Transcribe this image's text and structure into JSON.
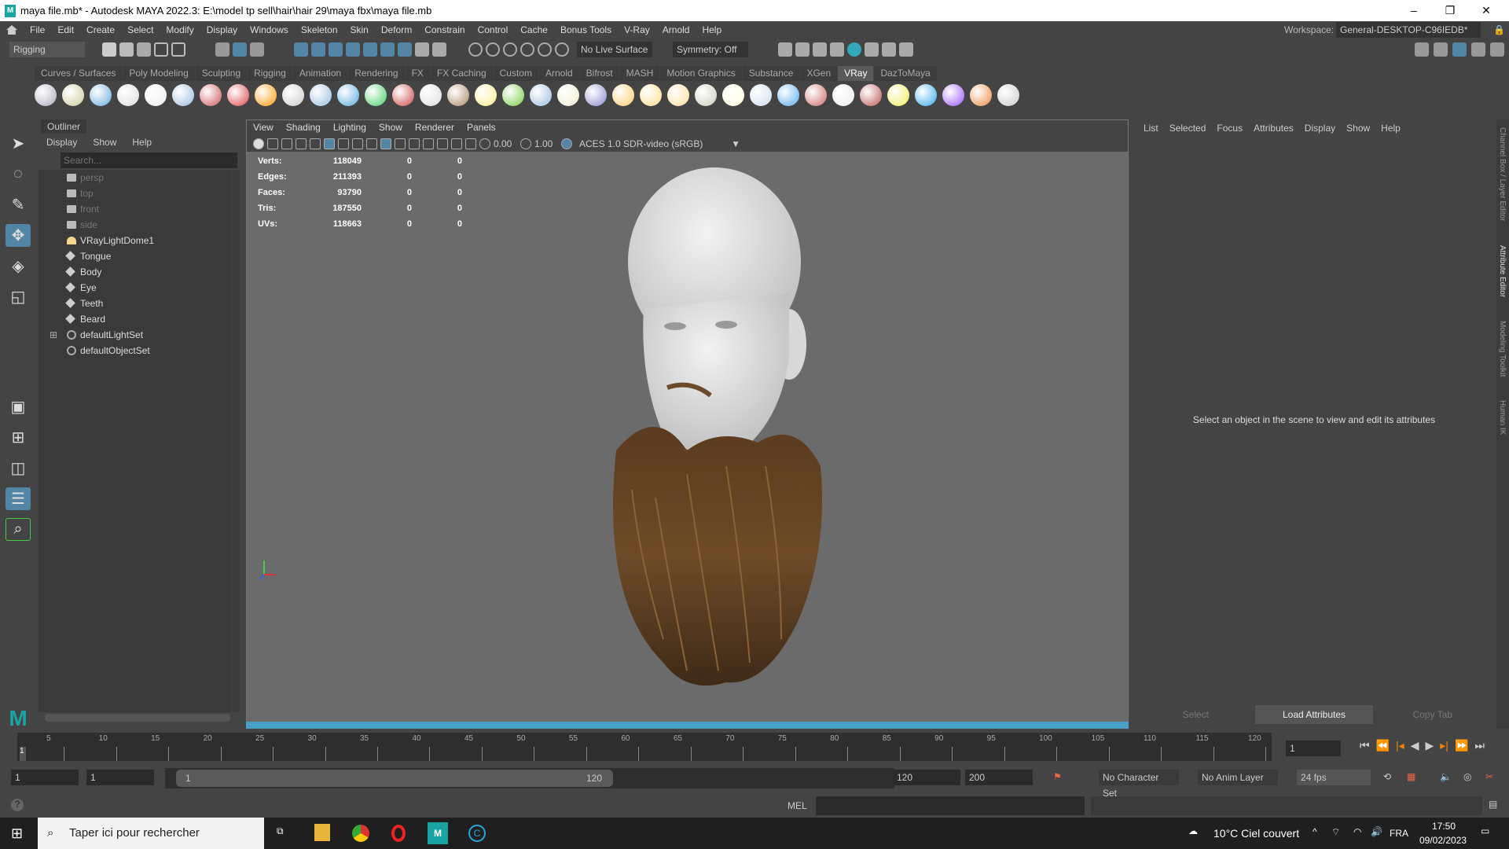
{
  "window": {
    "title": "maya file.mb* - Autodesk MAYA 2022.3: E:\\model tp sell\\hair\\hair 29\\maya fbx\\maya file.mb",
    "minimize": "–",
    "maximize": "❐",
    "close": "✕"
  },
  "menubar": {
    "items": [
      "File",
      "Edit",
      "Create",
      "Select",
      "Modify",
      "Display",
      "Windows",
      "Skeleton",
      "Skin",
      "Deform",
      "Constrain",
      "Control",
      "Cache",
      "Bonus Tools",
      "V-Ray",
      "Arnold",
      "Help"
    ],
    "workspace_label": "Workspace:",
    "workspace_value": "General-DESKTOP-C96IEDB*"
  },
  "statusline": {
    "menuset": "Rigging",
    "live_surface": "No Live Surface",
    "symmetry": "Symmetry: Off"
  },
  "shelf": {
    "tabs": [
      "Curves / Surfaces",
      "Poly Modeling",
      "Sculpting",
      "Rigging",
      "Animation",
      "Rendering",
      "FX",
      "FX Caching",
      "Custom",
      "Arnold",
      "Bifrost",
      "MASH",
      "Motion Graphics",
      "Substance",
      "XGen",
      "VRay",
      "DazToMaya"
    ],
    "active": "VRay",
    "icon_colors": [
      "#aab",
      "#cc9",
      "#6ad",
      "#ddd",
      "#eee",
      "#9bd",
      "#c55",
      "#d44",
      "#f90",
      "#ccc",
      "#9bd",
      "#5ad",
      "#4c6",
      "#c44",
      "#ddd",
      "#a86",
      "#fe8",
      "#7c4",
      "#9bd",
      "#eec",
      "#88c",
      "#fc6",
      "#fd8",
      "#fd9",
      "#ccb",
      "#ffd",
      "#cde",
      "#5ae",
      "#c66",
      "#eee",
      "#b55",
      "#ee5",
      "#3ae",
      "#95f",
      "#e84",
      "#ccc"
    ]
  },
  "outliner": {
    "title": "Outliner",
    "menu": [
      "Display",
      "Show",
      "Help"
    ],
    "search_placeholder": "Search...",
    "items": [
      {
        "label": "persp",
        "type": "camera",
        "dim": true
      },
      {
        "label": "top",
        "type": "camera",
        "dim": true
      },
      {
        "label": "front",
        "type": "camera",
        "dim": true
      },
      {
        "label": "side",
        "type": "camera",
        "dim": true
      },
      {
        "label": "VRayLightDome1",
        "type": "light"
      },
      {
        "label": "Tongue",
        "type": "mesh"
      },
      {
        "label": "Body",
        "type": "mesh"
      },
      {
        "label": "Eye",
        "type": "mesh"
      },
      {
        "label": "Teeth",
        "type": "mesh"
      },
      {
        "label": "Beard",
        "type": "mesh"
      },
      {
        "label": "defaultLightSet",
        "type": "set",
        "expand": "⊞"
      },
      {
        "label": "defaultObjectSet",
        "type": "set"
      }
    ]
  },
  "viewport": {
    "menu": [
      "View",
      "Shading",
      "Lighting",
      "Show",
      "Renderer",
      "Panels"
    ],
    "exposure": "0.00",
    "gamma": "1.00",
    "colorspace": "ACES 1.0 SDR-video (sRGB)",
    "stats": [
      {
        "label": "Verts:",
        "value": "118049",
        "a": "0",
        "b": "0"
      },
      {
        "label": "Edges:",
        "value": "211393",
        "a": "0",
        "b": "0"
      },
      {
        "label": "Faces:",
        "value": "93790",
        "a": "0",
        "b": "0"
      },
      {
        "label": "Tris:",
        "value": "187550",
        "a": "0",
        "b": "0"
      },
      {
        "label": "UVs:",
        "value": "118663",
        "a": "0",
        "b": "0"
      }
    ]
  },
  "attribute_editor": {
    "menu": [
      "List",
      "Selected",
      "Focus",
      "Attributes",
      "Display",
      "Show",
      "Help"
    ],
    "message": "Select an object in the scene to view and edit its attributes",
    "buttons": [
      "Select",
      "Load Attributes",
      "Copy Tab"
    ]
  },
  "side_tabs": [
    "Channel Box / Layer Editor",
    "Attribute Editor",
    "Modeling Toolkit",
    "Human IK"
  ],
  "timeline": {
    "start": 1,
    "end": 120,
    "labels": [
      "5",
      "10",
      "15",
      "20",
      "25",
      "30",
      "35",
      "40",
      "45",
      "50",
      "55",
      "60",
      "65",
      "70",
      "75",
      "80",
      "85",
      "90",
      "95",
      "100",
      "105",
      "110",
      "115",
      "120"
    ],
    "current_frame": "1",
    "current_label": "1"
  },
  "range": {
    "start": "1",
    "playback_start": "1",
    "slider_start": "1",
    "slider_end": "120",
    "playback_end": "120",
    "end": "200",
    "character_set": "No Character Set",
    "anim_layer": "No Anim Layer",
    "fps": "24 fps"
  },
  "cmdline": {
    "mode": "MEL",
    "help": "?"
  },
  "taskbar": {
    "search": "Taper ici pour rechercher",
    "weather": "10°C  Ciel couvert",
    "lang": "FRA",
    "time": "17:50",
    "date": "09/02/2023"
  }
}
